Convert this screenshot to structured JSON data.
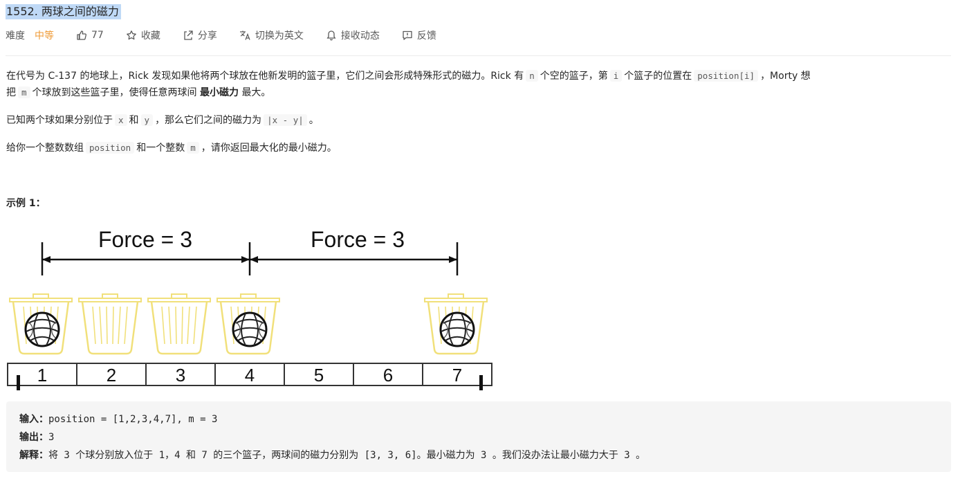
{
  "header": {
    "title": "1552. 两球之间的磁力",
    "difficulty_label": "难度",
    "difficulty_value": "中等",
    "likes": "77",
    "favorite": "收藏",
    "share": "分享",
    "translate": "切换为英文",
    "subscribe": "接收动态",
    "feedback": "反馈"
  },
  "description": {
    "p1_a": "在代号为 C-137 的地球上，Rick 发现如果他将两个球放在他新发明的篮子里，它们之间会形成特殊形式的磁力。Rick 有",
    "p1_n": "n",
    "p1_b": "个空的篮子，第",
    "p1_i": "i",
    "p1_c": "个篮子的位置在",
    "p1_pos": "position[i]",
    "p1_d": "，Morty 想",
    "p1_e": "把",
    "p1_m": "m",
    "p1_f": "个球放到这些篮子里，使得任意两球间",
    "p1_strong": "最小磁力",
    "p1_g": "最大。",
    "p2_a": "已知两个球如果分别位于",
    "p2_x": "x",
    "p2_b": "和",
    "p2_y": "y",
    "p2_c": "，那么它们之间的磁力为",
    "p2_abs": "|x - y|",
    "p2_d": "。",
    "p3_a": "给你一个整数数组",
    "p3_pos": "position",
    "p3_b": "和一个整数",
    "p3_m": "m",
    "p3_c": "，请你返回最大化的最小磁力。",
    "example_heading": "示例 1："
  },
  "figure": {
    "force_left": "Force = 3",
    "force_right": "Force = 3",
    "positions": [
      "1",
      "2",
      "3",
      "4",
      "5",
      "6",
      "7"
    ]
  },
  "example": {
    "input_label": "输入：",
    "input_value": "position = [1,2,3,4,7], m = 3",
    "output_label": "输出：",
    "output_value": "3",
    "explain_label": "解释：",
    "explain_value": "将 3 个球分别放入位于 1，4 和 7 的三个篮子，两球间的磁力分别为 [3, 3, 6]。最小磁力为 3 。我们没办法让最小磁力大于 3 。"
  }
}
